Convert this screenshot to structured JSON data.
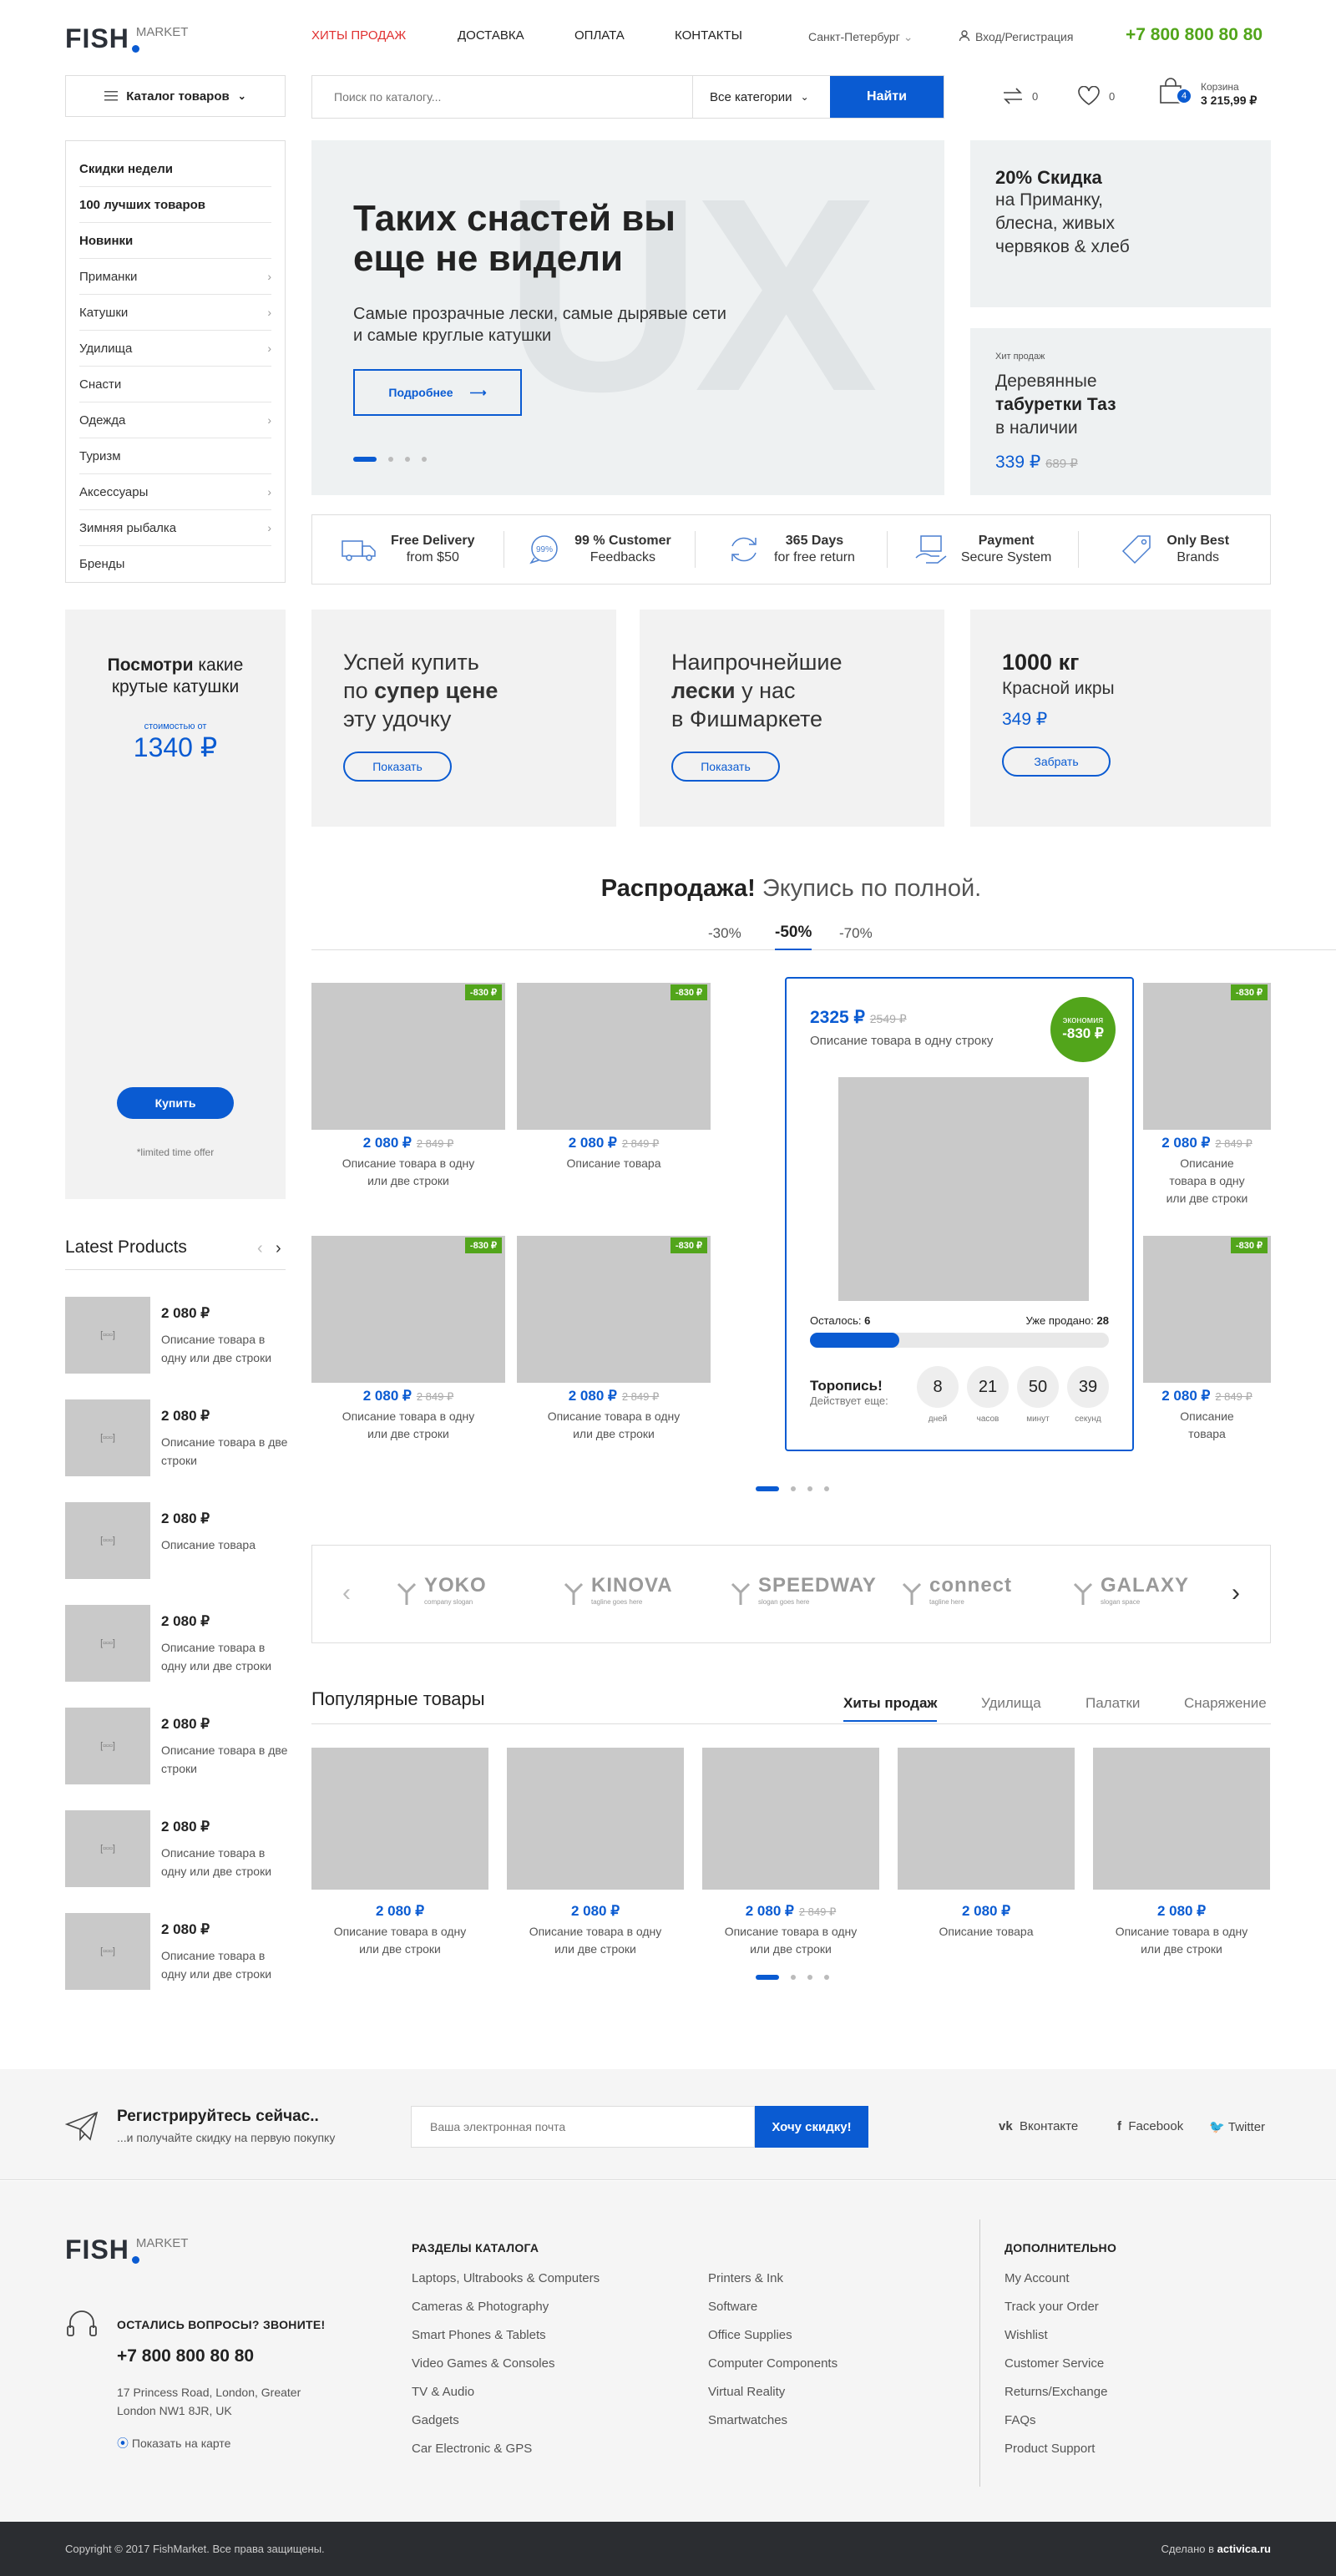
{
  "header": {
    "logo_main": "FISH",
    "logo_sub": "MARKET",
    "nav": [
      "ХИТЫ ПРОДАЖ",
      "ДОСТАВКА",
      "ОПЛАТА",
      "КОНТАКТЫ"
    ],
    "city": "Санкт-Петербург",
    "login": "Вход/Регистрация",
    "phone": "+7 800 800 80 80",
    "catalog": "Каталог товаров",
    "search_placeholder": "Поиск по каталогу...",
    "all_categories": "Все категории",
    "find": "Найти",
    "compare_count": "0",
    "wishlist_count": "0",
    "cart_count": "4",
    "cart_label": "Корзина",
    "cart_total": "3 215,99 ₽"
  },
  "menu": [
    "Скидки недели",
    "100 лучших товаров",
    "Новинки",
    "Приманки",
    "Катушки",
    "Удилища",
    "Снасти",
    "Одежда",
    "Туризм",
    "Аксессуары",
    "Зимняя рыбалка",
    "Бренды"
  ],
  "hero": {
    "bg": "UX",
    "title": "Таких снастей вы еще не видели",
    "text": "Самые прозрачные лески, самые дырявые сети и самые круглые катушки",
    "btn": "Подробнее"
  },
  "promo1": {
    "title": "20% Скидка",
    "text": "на Приманку, блесна, живых червяков & хлеб"
  },
  "promo2": {
    "label": "Хит продаж",
    "t1": "Деревянные",
    "t2": "табуретки Таз",
    "t3": "в наличии",
    "price": "339 ₽",
    "old": "689 ₽"
  },
  "features": [
    {
      "t": "Free Delivery",
      "s": "from $50"
    },
    {
      "t": "99 % Customer",
      "s": "Feedbacks",
      "icon": "99%"
    },
    {
      "t": "365 Days",
      "s": "for free return"
    },
    {
      "t": "Payment",
      "s": "Secure System"
    },
    {
      "t": "Only Best",
      "s": "Brands"
    }
  ],
  "side_promo": {
    "b": "Посмотри",
    "t": "какие крутые катушки",
    "from": "стоимостью от",
    "price": "1340 ₽",
    "btn": "Купить",
    "note": "*limited time offer"
  },
  "cards": [
    {
      "l1": "Успей купить",
      "l2a": "по ",
      "l2b": "супер цене",
      "l3": "эту удочку",
      "btn": "Показать"
    },
    {
      "l1": "Наипрочнейшие",
      "l2a": "лески",
      "l2b": " у нас",
      "l3": "в Фишмаркете",
      "btn": "Показать"
    },
    {
      "l1": "1000 кг",
      "l2": "Красной икры",
      "price": "349 ₽",
      "btn": "Забрать"
    }
  ],
  "sale": {
    "b": "Распродажа!",
    "t": " Экупись по полной.",
    "tabs": [
      "-30%",
      "-50%",
      "-70%"
    ]
  },
  "products": [
    {
      "tag": "-830 ₽",
      "price": "2 080 ₽",
      "old": "2 849 ₽",
      "d": "Описание товара в одну или две строки"
    },
    {
      "tag": "-830 ₽",
      "price": "2 080 ₽",
      "old": "2 849 ₽",
      "d": "Описание товара"
    },
    {
      "tag": "-830 ₽",
      "price": "2 080 ₽",
      "old": "2 849 ₽",
      "d": "Описание товара в одну или две строки"
    },
    {
      "tag": "-830 ₽",
      "price": "2 080 ₽",
      "old": "2 849 ₽",
      "d": "Описание товара в одну или две строки"
    },
    {
      "tag": "-830 ₽",
      "price": "2 080 ₽",
      "old": "2 849 ₽",
      "d": "Описание товара в одну или две строки"
    },
    {
      "tag": "-830 ₽",
      "price": "2 080 ₽",
      "old": "2 849 ₽",
      "d": "Описание товара"
    }
  ],
  "featured": {
    "price": "2325 ₽",
    "old": "2549 ₽",
    "desc": "Описание товара в одну строку",
    "save_l": "экономия",
    "save": "-830 ₽",
    "left_l": "Осталось:",
    "left": "6",
    "sold_l": "Уже продано:",
    "sold": "28",
    "sold_fraction": 0.3,
    "hurry": "Торопись!",
    "acts": "Действует еще:",
    "timer": [
      {
        "v": "8",
        "l": "дней"
      },
      {
        "v": "21",
        "l": "часов"
      },
      {
        "v": "50",
        "l": "минут"
      },
      {
        "v": "39",
        "l": "секунд"
      }
    ]
  },
  "latest": {
    "title": "Latest Products",
    "items": [
      {
        "p": "2 080 ₽",
        "d": "Описание товара в одну или две строки"
      },
      {
        "p": "2 080 ₽",
        "d": "Описание товара в две строки"
      },
      {
        "p": "2 080 ₽",
        "d": "Описание товара"
      },
      {
        "p": "2 080 ₽",
        "d": "Описание товара в одну или две строки"
      },
      {
        "p": "2 080 ₽",
        "d": "Описание товара в две строки"
      },
      {
        "p": "2 080 ₽",
        "d": "Описание товара в одну или две строки"
      },
      {
        "p": "2 080 ₽",
        "d": "Описание товара в одну или две строки"
      }
    ]
  },
  "brands": [
    {
      "n": "YOKO",
      "s": "company slogan"
    },
    {
      "n": "KINOVA",
      "s": "tagline goes here"
    },
    {
      "n": "SPEEDWAY",
      "s": "slogan goes here"
    },
    {
      "n": "connect",
      "s": "tagline here"
    },
    {
      "n": "GALAXY",
      "s": "slogan space"
    }
  ],
  "popular": {
    "title": "Популярные товары",
    "tabs": [
      "Хиты продаж",
      "Удилища",
      "Палатки",
      "Снаряжение"
    ],
    "items": [
      {
        "p": "2 080 ₽",
        "d": "Описание товара в одну или две строки"
      },
      {
        "p": "2 080 ₽",
        "d": "Описание товара в одну или две строки"
      },
      {
        "p": "2 080 ₽",
        "old": "2 849 ₽",
        "d": "Описание товара в одну или две строки"
      },
      {
        "p": "2 080 ₽",
        "d": "Описание товара"
      },
      {
        "p": "2 080 ₽",
        "d": "Описание товара в одну или две строки"
      }
    ]
  },
  "newsletter": {
    "t": "Регистрируйтесь сейчас..",
    "s": "...и получайте скидку на первую покупку",
    "placeholder": "Ваша электронная почта",
    "btn": "Хочу скидку!",
    "social": [
      "Вконтакте",
      "Facebook",
      "Twitter"
    ]
  },
  "footer": {
    "q": "ОСТАЛИСЬ ВОПРОСЫ? ЗВОНИТЕ!",
    "phone": "+7 800 800 80 80",
    "addr": "17 Princess Road, London, Greater London NW1 8JR, UK",
    "map": "Показать на карте",
    "sections_h": "РАЗДЕЛЫ КАТАЛОГА",
    "col1": [
      "Laptops, Ultrabooks & Computers",
      "Cameras & Photography",
      "Smart Phones & Tablets",
      "Video Games & Consoles",
      "TV & Audio",
      "Gadgets",
      "Car Electronic & GPS"
    ],
    "col2": [
      "Printers & Ink",
      "Software",
      "Office Supplies",
      "Computer Components",
      "Virtual Reality",
      "Smartwatches"
    ],
    "extra_h": "ДОПОЛНИТЕЛЬНО",
    "col3": [
      "My Account",
      "Track your Order",
      "Wishlist",
      "Customer Service",
      "Returns/Exchange",
      "FAQs",
      "Product Support"
    ]
  },
  "copyright": "Copyright © 2017 FishMarket. Все права защищены.",
  "made": "Сделано в ",
  "made_brand": "activica.ru"
}
